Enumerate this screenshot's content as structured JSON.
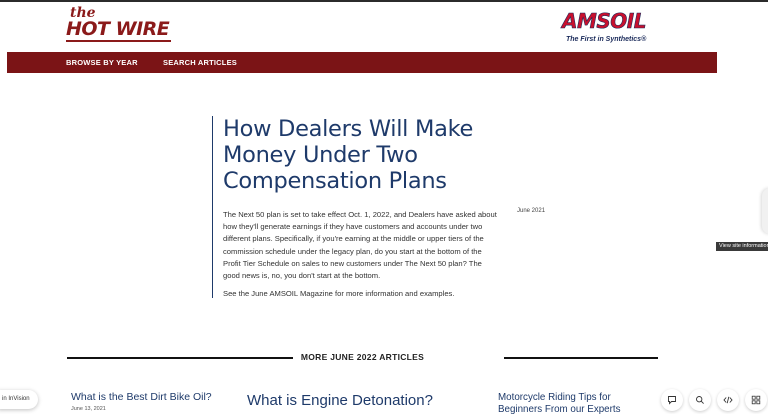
{
  "brand": {
    "line1": "the",
    "line2": "HOT WIRE"
  },
  "partner": {
    "name": "AMSOIL",
    "tagline": "The First in Synthetics®"
  },
  "nav": {
    "items": [
      "BROWSE BY YEAR",
      "SEARCH ARTICLES"
    ]
  },
  "article": {
    "title": "How Dealers Will Make Money Under Two Compensation Plans",
    "date": "June 2021",
    "paragraphs": [
      "The Next 50 plan is set to take effect Oct. 1, 2022, and Dealers have asked about how they'll generate earnings if they have customers and accounts under two different plans. Specifically, if you're earning at the middle or upper tiers of the commission schedule under the legacy plan, do you start at the bottom of the Profit Tier Schedule on sales to new customers under The Next 50 plan? The good news is, no, you don't start at the bottom.",
      "See the June AMSOIL Magazine for more information and examples."
    ]
  },
  "more_articles": {
    "heading": "MORE JUNE 2022 ARTICLES",
    "items": [
      {
        "title": "What is the Best Dirt Bike Oil?",
        "date": "June 13, 2021"
      },
      {
        "title": "What is Engine Detonation?"
      },
      {
        "title": "Motorcycle Riding Tips for Beginners From our Experts"
      }
    ]
  },
  "overlay": {
    "tooltip": "View site information",
    "invision_label": "in InVision",
    "tools": [
      "comment-icon",
      "search-icon",
      "code-icon",
      "grid-icon"
    ]
  },
  "colors": {
    "brand_red": "#7b1416",
    "title_blue": "#1e3a6a"
  }
}
